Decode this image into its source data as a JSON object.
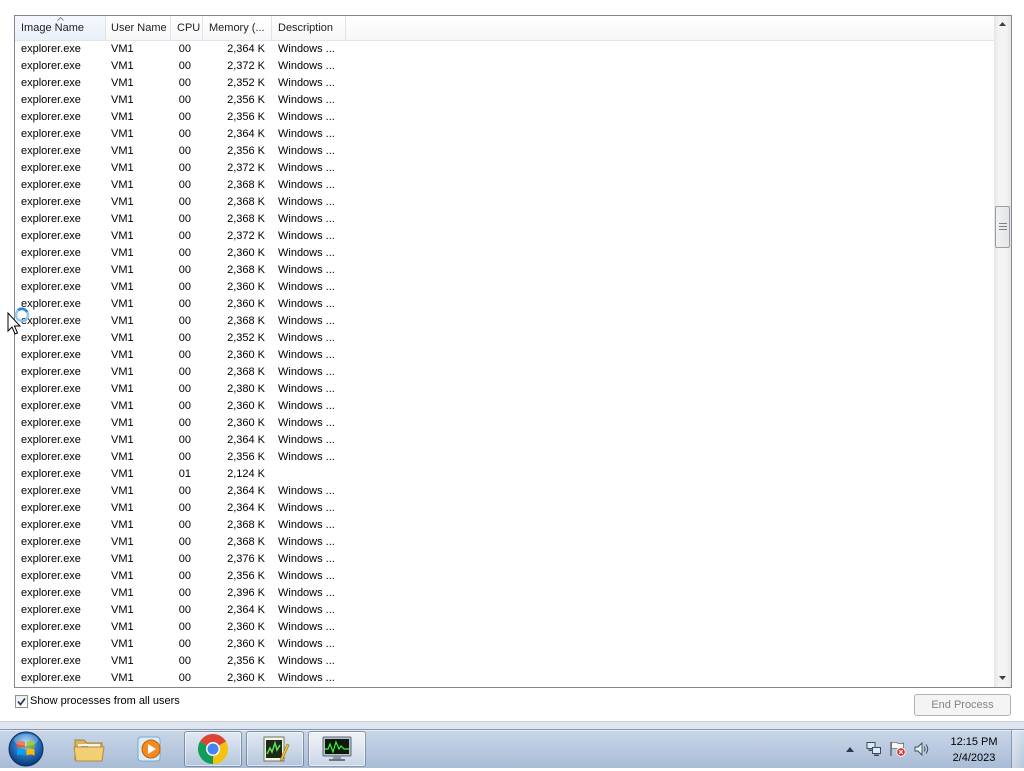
{
  "process_list": {
    "columns": [
      "Image Name",
      "User Name",
      "CPU",
      "Memory (...",
      "Description"
    ],
    "sort_icon": "sort-ascending-icon",
    "rows": [
      [
        "explorer.exe",
        "VM1",
        "00",
        "2,364 K",
        "Windows ..."
      ],
      [
        "explorer.exe",
        "VM1",
        "00",
        "2,372 K",
        "Windows ..."
      ],
      [
        "explorer.exe",
        "VM1",
        "00",
        "2,352 K",
        "Windows ..."
      ],
      [
        "explorer.exe",
        "VM1",
        "00",
        "2,356 K",
        "Windows ..."
      ],
      [
        "explorer.exe",
        "VM1",
        "00",
        "2,356 K",
        "Windows ..."
      ],
      [
        "explorer.exe",
        "VM1",
        "00",
        "2,364 K",
        "Windows ..."
      ],
      [
        "explorer.exe",
        "VM1",
        "00",
        "2,356 K",
        "Windows ..."
      ],
      [
        "explorer.exe",
        "VM1",
        "00",
        "2,372 K",
        "Windows ..."
      ],
      [
        "explorer.exe",
        "VM1",
        "00",
        "2,368 K",
        "Windows ..."
      ],
      [
        "explorer.exe",
        "VM1",
        "00",
        "2,368 K",
        "Windows ..."
      ],
      [
        "explorer.exe",
        "VM1",
        "00",
        "2,368 K",
        "Windows ..."
      ],
      [
        "explorer.exe",
        "VM1",
        "00",
        "2,372 K",
        "Windows ..."
      ],
      [
        "explorer.exe",
        "VM1",
        "00",
        "2,360 K",
        "Windows ..."
      ],
      [
        "explorer.exe",
        "VM1",
        "00",
        "2,368 K",
        "Windows ..."
      ],
      [
        "explorer.exe",
        "VM1",
        "00",
        "2,360 K",
        "Windows ..."
      ],
      [
        "explorer.exe",
        "VM1",
        "00",
        "2,360 K",
        "Windows ..."
      ],
      [
        "explorer.exe",
        "VM1",
        "00",
        "2,368 K",
        "Windows ..."
      ],
      [
        "explorer.exe",
        "VM1",
        "00",
        "2,352 K",
        "Windows ..."
      ],
      [
        "explorer.exe",
        "VM1",
        "00",
        "2,360 K",
        "Windows ..."
      ],
      [
        "explorer.exe",
        "VM1",
        "00",
        "2,368 K",
        "Windows ..."
      ],
      [
        "explorer.exe",
        "VM1",
        "00",
        "2,380 K",
        "Windows ..."
      ],
      [
        "explorer.exe",
        "VM1",
        "00",
        "2,360 K",
        "Windows ..."
      ],
      [
        "explorer.exe",
        "VM1",
        "00",
        "2,360 K",
        "Windows ..."
      ],
      [
        "explorer.exe",
        "VM1",
        "00",
        "2,364 K",
        "Windows ..."
      ],
      [
        "explorer.exe",
        "VM1",
        "00",
        "2,356 K",
        "Windows ..."
      ],
      [
        "explorer.exe",
        "VM1",
        "01",
        "2,124 K",
        ""
      ],
      [
        "explorer.exe",
        "VM1",
        "00",
        "2,364 K",
        "Windows ..."
      ],
      [
        "explorer.exe",
        "VM1",
        "00",
        "2,364 K",
        "Windows ..."
      ],
      [
        "explorer.exe",
        "VM1",
        "00",
        "2,368 K",
        "Windows ..."
      ],
      [
        "explorer.exe",
        "VM1",
        "00",
        "2,368 K",
        "Windows ..."
      ],
      [
        "explorer.exe",
        "VM1",
        "00",
        "2,376 K",
        "Windows ..."
      ],
      [
        "explorer.exe",
        "VM1",
        "00",
        "2,356 K",
        "Windows ..."
      ],
      [
        "explorer.exe",
        "VM1",
        "00",
        "2,396 K",
        "Windows ..."
      ],
      [
        "explorer.exe",
        "VM1",
        "00",
        "2,364 K",
        "Windows ..."
      ],
      [
        "explorer.exe",
        "VM1",
        "00",
        "2,360 K",
        "Windows ..."
      ],
      [
        "explorer.exe",
        "VM1",
        "00",
        "2,360 K",
        "Windows ..."
      ],
      [
        "explorer.exe",
        "VM1",
        "00",
        "2,356 K",
        "Windows ..."
      ],
      [
        "explorer.exe",
        "VM1",
        "00",
        "2,360 K",
        "Windows ..."
      ]
    ],
    "scrollbar": {
      "scrolled_percent": 29
    }
  },
  "footer": {
    "show_all_users_label": "Show processes from all users",
    "show_all_users_checked": true,
    "end_process_label": "End Process",
    "end_process_enabled": false
  },
  "taskbar": {
    "start_icon": "start-orb-icon",
    "buttons": [
      {
        "icon": "folder-icon",
        "running": false,
        "active": false
      },
      {
        "icon": "media-player-icon",
        "running": false,
        "active": false
      },
      {
        "icon": "chrome-icon",
        "running": true,
        "active": false
      },
      {
        "icon": "chart-notepad-icon",
        "running": true,
        "active": false
      },
      {
        "icon": "task-manager-icon",
        "running": true,
        "active": true
      }
    ],
    "tray_icons": [
      "tray-overflow-arrow-icon",
      "network-icon",
      "action-center-alert-icon",
      "speaker-icon"
    ],
    "clock": {
      "time": "12:15 PM",
      "date": "2/4/2023"
    }
  },
  "colors": {
    "list_border": "#828790",
    "disabled_text": "#838383",
    "taskbar": "#b9c9df"
  }
}
